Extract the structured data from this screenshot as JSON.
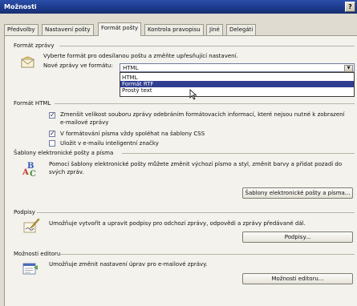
{
  "window": {
    "title": "Možnosti",
    "help_label": "?"
  },
  "tabs": [
    {
      "label": "Předvolby"
    },
    {
      "label": "Nastavení pošty"
    },
    {
      "label": "Formát pošty"
    },
    {
      "label": "Kontrola pravopisu"
    },
    {
      "label": "Jiné"
    },
    {
      "label": "Delegáti"
    }
  ],
  "message_format": {
    "section_label": "Formát zprávy",
    "description": "Vyberte formát pro odesílanou poštu a změňte upřesňující nastavení.",
    "compose_label": "Nové zprávy ve formátu:",
    "selected": "HTML",
    "options": [
      "HTML",
      "Formát RTF",
      "Prostý text"
    ],
    "highlighted_option": "Formát RTF"
  },
  "html_format": {
    "section_label": "Formát HTML",
    "options": [
      {
        "label": "Zmenšit velikost souboru zprávy odebráním formátovacích informací, které nejsou nutné k zobrazení e-mailové zprávy",
        "checked": true
      },
      {
        "label": "V formátování písma vždy spoléhat na šablony CSS",
        "checked": true
      },
      {
        "label": "Uložit v e-mailu inteligentní značky",
        "checked": false
      }
    ]
  },
  "stationery": {
    "section_label": "Šablony elektronické pošty a písma",
    "description": "Pomocí šablony elektronické pošty můžete změnit výchozí písmo a styl, změnit barvy a přidat pozadí do svých zpráv.",
    "button_label": "Šablony elektronické pošty a písma..."
  },
  "signatures": {
    "section_label": "Podpisy",
    "description": "Umožňuje vytvořit a upravit podpisy pro odchozí zprávy, odpovědi a zprávy předávané dál.",
    "button_label": "Podpisy..."
  },
  "editor": {
    "section_label": "Možnosti editoru",
    "description": "Umožňuje změnit nastavení úprav pro e-mailové zprávy.",
    "button_label": "Možnosti editoru..."
  },
  "icons": {
    "message_format": "envelope-icon",
    "stationery": "stationery-abc-icon",
    "signatures": "signature-pen-icon",
    "editor": "editor-options-icon"
  },
  "colors": {
    "titlebar": "#1d3a8c",
    "dialog_bg": "#dfdbd0",
    "selection": "#2f3e8f"
  }
}
